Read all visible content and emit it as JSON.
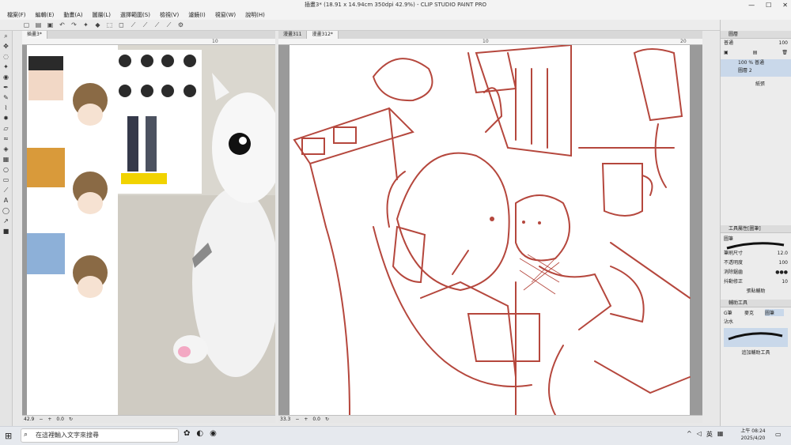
{
  "window": {
    "title": "插畫3* (18.91 x 14.94cm 350dpi 42.9%) - CLIP STUDIO PAINT PRO",
    "controls": [
      "—",
      "☐",
      "✕"
    ]
  },
  "menu": [
    "檔案(F)",
    "編輯(E)",
    "動畫(A)",
    "圖層(L)",
    "選擇範圍(S)",
    "檢視(V)",
    "濾鏡(I)",
    "視窗(W)",
    "說明(H)"
  ],
  "canvas1": {
    "tab": "插畫3*",
    "ruler_marks": [
      "10"
    ],
    "status": {
      "zoom": "42.9",
      "angle": "0.0"
    }
  },
  "canvas2": {
    "tabs": [
      "漫畫311",
      "漫畫312*"
    ],
    "ruler_marks": [
      "10",
      "20"
    ],
    "status": {
      "zoom": "33.3",
      "angle": "0.0"
    }
  },
  "layer_panel": {
    "header": "圖層",
    "blend_mode": "普通",
    "opacity": "100",
    "layers": [
      {
        "name": "100 % 普通",
        "sub": "圖層 2"
      },
      {
        "name": "紙張",
        "sub": ""
      }
    ]
  },
  "tool_property": {
    "header": "工具屬性[圖筆]",
    "tool": "圖筆",
    "rows": [
      {
        "label": "筆刷尺寸",
        "value": "12.0"
      },
      {
        "label": "不透明度",
        "value": "100"
      },
      {
        "label": "消除鋸齒",
        "value": ""
      },
      {
        "label": "抖動修正",
        "value": "10"
      }
    ],
    "detail_link": "張貼輔助"
  },
  "sub_tool": {
    "header": "輔助工具",
    "items": [
      "G筆",
      "麥克",
      "圖筆",
      "沾水"
    ],
    "add_button": "追加輔助工具"
  },
  "taskbar": {
    "search_placeholder": "在這裡輸入文字來搜尋",
    "time": "上午 08:24",
    "date": "2025/4/20",
    "ime": "英"
  }
}
